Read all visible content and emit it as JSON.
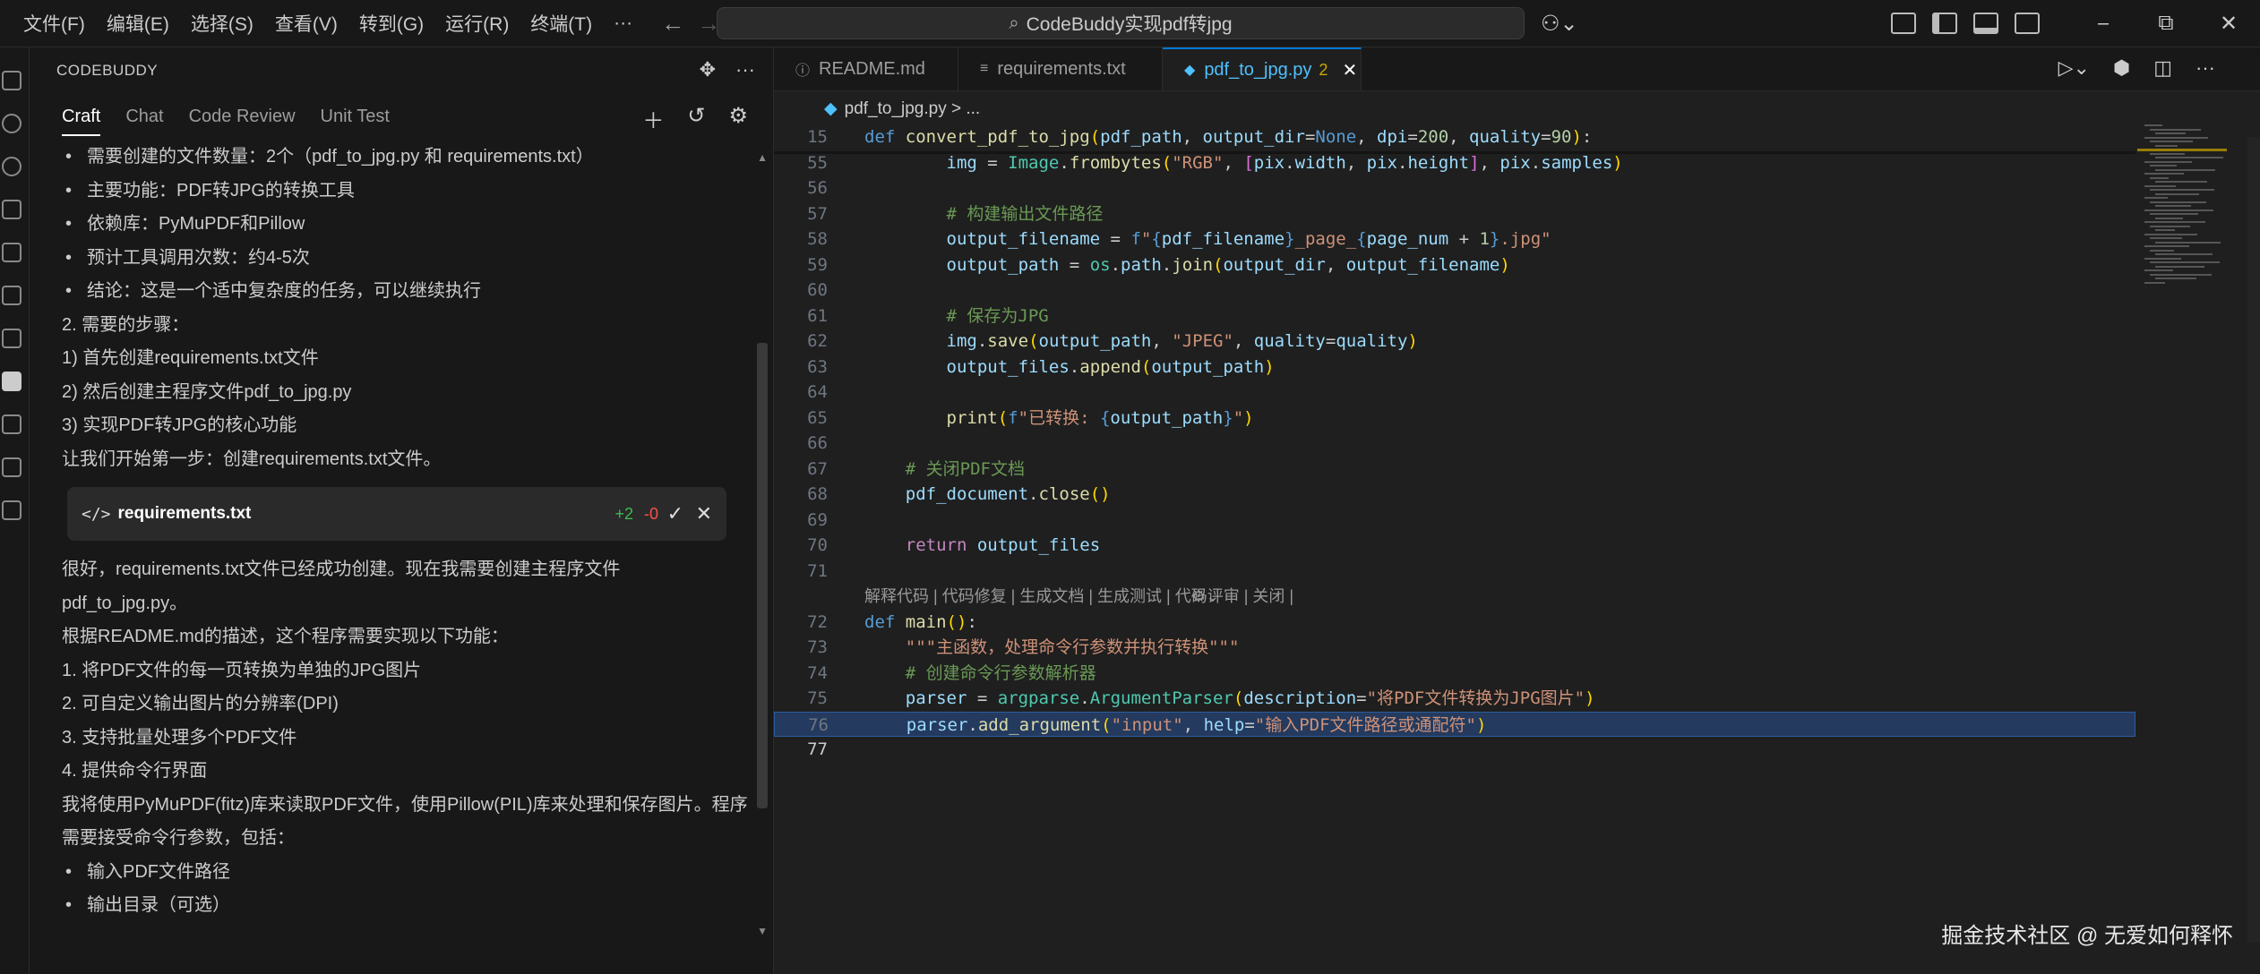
{
  "menu": [
    "文件(F)",
    "编辑(E)",
    "选择(S)",
    "查看(V)",
    "转到(G)",
    "运行(R)",
    "终端(T)",
    "···"
  ],
  "title": {
    "search": "CodeBuddy实现pdf转jpg"
  },
  "sidebar": {
    "title": "CODEBUDDY",
    "tabs": [
      "Craft",
      "Chat",
      "Code Review",
      "Unit Test"
    ],
    "messages1": [
      {
        "type": "bullet",
        "text": "需要创建的文件数量：2个（pdf_to_jpg.py 和 requirements.txt）"
      },
      {
        "type": "bullet",
        "text": "主要功能：PDF转JPG的转换工具"
      },
      {
        "type": "bullet",
        "text": "依赖库：PyMuPDF和Pillow"
      },
      {
        "type": "bullet",
        "text": "预计工具调用次数：约4-5次"
      },
      {
        "type": "bullet",
        "text": "结论：这是一个适中复杂度的任务，可以继续执行"
      },
      {
        "type": "p",
        "text": "2. 需要的步骤："
      },
      {
        "type": "p",
        "text": "1) 首先创建requirements.txt文件"
      },
      {
        "type": "p",
        "text": "2) 然后创建主程序文件pdf_to_jpg.py"
      },
      {
        "type": "p",
        "text": "3) 实现PDF转JPG的核心功能"
      },
      {
        "type": "p",
        "text": "让我们开始第一步：创建requirements.txt文件。"
      }
    ],
    "file_card": {
      "icon": "</>",
      "name": "requirements.txt",
      "added": "+2",
      "removed": "-0"
    },
    "messages2": [
      {
        "type": "p",
        "text": "很好，requirements.txt文件已经成功创建。现在我需要创建主程序文件"
      },
      {
        "type": "p",
        "text": "pdf_to_jpg.py。"
      },
      {
        "type": "p",
        "text": "根据README.md的描述，这个程序需要实现以下功能："
      },
      {
        "type": "p",
        "text": "1. 将PDF文件的每一页转换为单独的JPG图片"
      },
      {
        "type": "p",
        "text": "2. 可自定义输出图片的分辨率(DPI)"
      },
      {
        "type": "p",
        "text": "3. 支持批量处理多个PDF文件"
      },
      {
        "type": "p",
        "text": "4. 提供命令行界面"
      },
      {
        "type": "p",
        "text": "我将使用PyMuPDF(fitz)库来读取PDF文件，使用Pillow(PIL)库来处理和保存图片。程序"
      },
      {
        "type": "p",
        "text": "需要接受命令行参数，包括："
      },
      {
        "type": "bullet",
        "text": "输入PDF文件路径"
      },
      {
        "type": "bullet",
        "text": "输出目录（可选）"
      }
    ]
  },
  "editor": {
    "tabs": [
      {
        "icon": "ⓘ",
        "label": "README.md",
        "active": false,
        "badge": ""
      },
      {
        "icon": "≡",
        "label": "requirements.txt",
        "active": false,
        "badge": ""
      },
      {
        "icon": "◆",
        "label": "pdf_to_jpg.py",
        "active": true,
        "badge": "2"
      }
    ],
    "breadcrumb": "pdf_to_jpg.py > ...",
    "codelens": "解释代码 | 代码修复 | 生成文档 | 生成测试 | 代码评审 | 关闭 | ",
    "codelens_icon": "spiral-icon",
    "lines": [
      {
        "n": "15",
        "html": "<span class=\"kw\">def</span> <span class=\"fn\">convert_pdf_to_jpg</span><span class=\"br\">(</span><span class=\"var\">pdf_path</span>, <span class=\"var\">output_dir</span>=<span class=\"bl\">None</span>, <span class=\"var\">dpi</span>=<span class=\"num\">200</span>, <span class=\"var\">quality</span>=<span class=\"num\">90</span><span class=\"br\">)</span>:"
      },
      {
        "n": "55",
        "html": "        <span class=\"var\">img</span> = <span class=\"cls\">Image</span>.<span class=\"fn\">frombytes</span><span class=\"br\">(</span><span class=\"str\">\"RGB\"</span>, <span class=\"br2\">[</span><span class=\"var\">pix</span>.<span class=\"var\">width</span>, <span class=\"var\">pix</span>.<span class=\"var\">height</span><span class=\"br2\">]</span>, <span class=\"var\">pix</span>.<span class=\"var\">samples</span><span class=\"br\">)</span>"
      },
      {
        "n": "56",
        "html": ""
      },
      {
        "n": "57",
        "html": "        <span class=\"cm\"># 构建输出文件路径</span>"
      },
      {
        "n": "58",
        "html": "        <span class=\"var\">output_filename</span> = <span class=\"bl\">f</span><span class=\"str\">\"</span><span class=\"bl\">{</span><span class=\"var\">pdf_filename</span><span class=\"bl\">}</span><span class=\"str\">_page_</span><span class=\"bl\">{</span><span class=\"var\">page_num</span> + <span class=\"num\">1</span><span class=\"bl\">}</span><span class=\"str\">.jpg\"</span>"
      },
      {
        "n": "59",
        "html": "        <span class=\"var\">output_path</span> = <span class=\"cls\">os</span>.<span class=\"var\">path</span>.<span class=\"fn\">join</span><span class=\"br\">(</span><span class=\"var\">output_dir</span>, <span class=\"var\">output_filename</span><span class=\"br\">)</span>"
      },
      {
        "n": "60",
        "html": ""
      },
      {
        "n": "61",
        "html": "        <span class=\"cm\"># 保存为JPG</span>"
      },
      {
        "n": "62",
        "html": "        <span class=\"var\">img</span>.<span class=\"fn\">save</span><span class=\"br\">(</span><span class=\"var\">output_path</span>, <span class=\"str\">\"JPEG\"</span>, <span class=\"var\">quality</span>=<span class=\"var\">quality</span><span class=\"br\">)</span>"
      },
      {
        "n": "63",
        "html": "        <span class=\"var\">output_files</span>.<span class=\"fn\">append</span><span class=\"br\">(</span><span class=\"var\">output_path</span><span class=\"br\">)</span>"
      },
      {
        "n": "64",
        "html": ""
      },
      {
        "n": "65",
        "html": "        <span class=\"fn\">print</span><span class=\"br\">(</span><span class=\"bl\">f</span><span class=\"str\">\"已转换: </span><span class=\"bl\">{</span><span class=\"var\">output_path</span><span class=\"bl\">}</span><span class=\"str\">\"</span><span class=\"br\">)</span>"
      },
      {
        "n": "66",
        "html": ""
      },
      {
        "n": "67",
        "html": "    <span class=\"cm\"># 关闭PDF文档</span>"
      },
      {
        "n": "68",
        "html": "    <span class=\"var\">pdf_document</span>.<span class=\"fn\">close</span><span class=\"br\">()</span>"
      },
      {
        "n": "69",
        "html": ""
      },
      {
        "n": "70",
        "html": "    <span class=\"kw2\">return</span> <span class=\"var\">output_files</span>"
      },
      {
        "n": "71",
        "html": ""
      },
      {
        "n": "",
        "html": "__CODELENS__"
      },
      {
        "n": "72",
        "html": "<span class=\"kw\">def</span> <span class=\"fn\">main</span><span class=\"br\">()</span>:"
      },
      {
        "n": "73",
        "html": "    <span class=\"str\">\"\"\"主函数，处理命令行参数并执行转换\"\"\"</span>"
      },
      {
        "n": "74",
        "html": "    <span class=\"cm\"># 创建命令行参数解析器</span>"
      },
      {
        "n": "75",
        "html": "    <span class=\"var\">parser</span> = <span class=\"cls\">argparse</span>.<span class=\"cls\">ArgumentParser</span><span class=\"br\">(</span><span class=\"var\">description</span>=<span class=\"str\">\"将PDF文件转换为JPG图片\"</span><span class=\"br\">)</span>"
      },
      {
        "n": "76",
        "html": "    <span class=\"var\">parser</span>.<span class=\"fn\">add_argument</span><span class=\"br\">(</span><span class=\"str\">\"input\"</span>, <span class=\"var\">help</span>=<span class=\"str\">\"输入PDF文件路径或通配符\"</span><span class=\"br\">)</span>"
      },
      {
        "n": "77",
        "html": ""
      }
    ],
    "current_line": "77",
    "highlight_line": "76"
  },
  "watermark": "掘金技术社区 @ 无爱如何释怀"
}
